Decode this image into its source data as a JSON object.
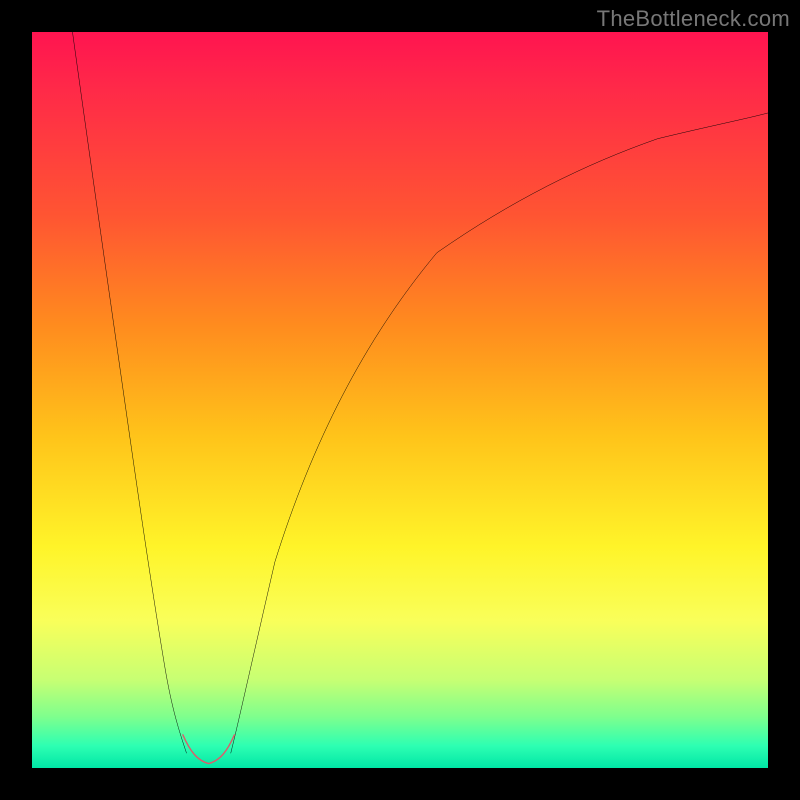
{
  "watermark": "TheBottleneck.com",
  "chart_data": {
    "type": "line",
    "title": "",
    "xlabel": "",
    "ylabel": "",
    "xlim": [
      0,
      100
    ],
    "ylim": [
      0,
      100
    ],
    "background_gradient": {
      "direction": "top-to-bottom",
      "stops": [
        {
          "pos": 0.0,
          "color": "#ff1450"
        },
        {
          "pos": 0.08,
          "color": "#ff2a48"
        },
        {
          "pos": 0.25,
          "color": "#ff5532"
        },
        {
          "pos": 0.4,
          "color": "#ff8c1e"
        },
        {
          "pos": 0.55,
          "color": "#ffc41a"
        },
        {
          "pos": 0.7,
          "color": "#fff429"
        },
        {
          "pos": 0.8,
          "color": "#f9ff5a"
        },
        {
          "pos": 0.88,
          "color": "#c7ff73"
        },
        {
          "pos": 0.93,
          "color": "#7fff8d"
        },
        {
          "pos": 0.97,
          "color": "#2dffb2"
        },
        {
          "pos": 1.0,
          "color": "#00e6a6"
        }
      ]
    },
    "series": [
      {
        "name": "left-branch",
        "stroke": "#000000",
        "stroke_width": 3,
        "x": [
          5.5,
          8,
          10,
          12,
          14,
          16,
          18,
          20,
          21
        ],
        "y": [
          100,
          82,
          68,
          54,
          40,
          26,
          14,
          5,
          2
        ]
      },
      {
        "name": "right-branch",
        "stroke": "#000000",
        "stroke_width": 3,
        "x": [
          27,
          28,
          30,
          33,
          38,
          45,
          55,
          65,
          75,
          85,
          95,
          100
        ],
        "y": [
          2,
          6,
          15,
          28,
          44,
          58,
          70,
          77,
          82,
          85.5,
          88,
          89
        ]
      },
      {
        "name": "valley-highlight",
        "stroke": "#d8606c",
        "stroke_width": 10,
        "linecap": "round",
        "x": [
          20.5,
          21.5,
          22.5,
          23.5,
          24.5,
          25.5,
          26.5,
          27.5
        ],
        "y": [
          4.5,
          2.2,
          1.0,
          0.6,
          0.6,
          1.0,
          2.2,
          4.5
        ]
      }
    ]
  }
}
